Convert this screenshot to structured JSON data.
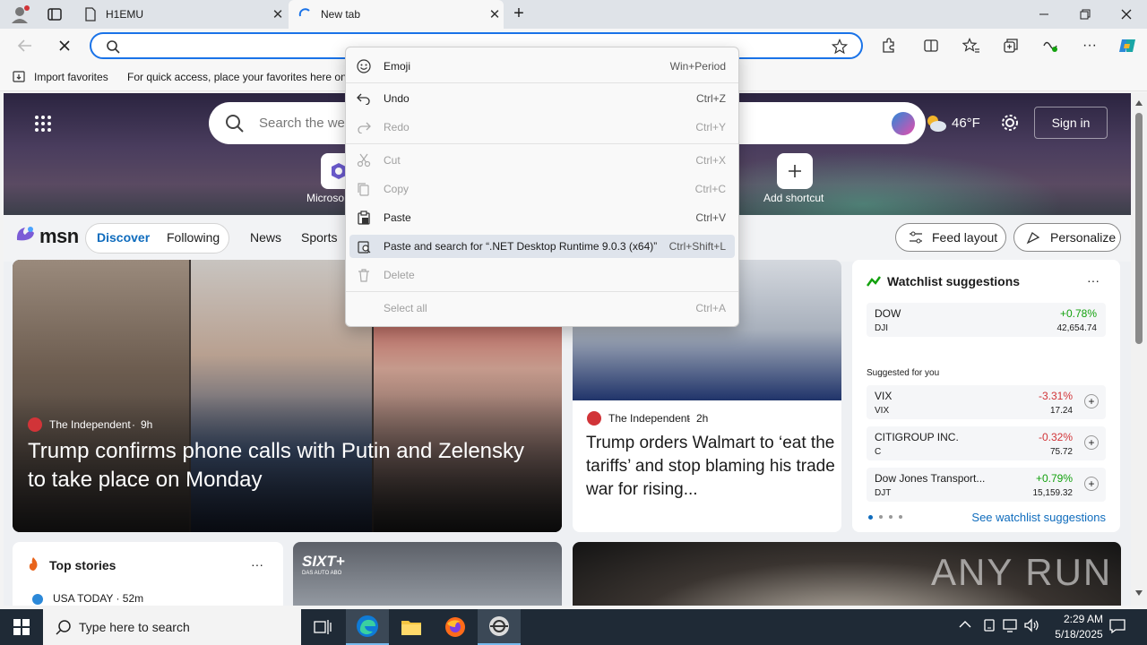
{
  "browser": {
    "tabs": [
      {
        "title": "H1EMU"
      },
      {
        "title": "New tab"
      }
    ],
    "favorites_bar": {
      "import_label": "Import favorites",
      "hint": "For quick access, place your favorites here on t"
    }
  },
  "msn": {
    "search_placeholder": "Search the we",
    "weather": "46°F",
    "sign_in": "Sign in",
    "shortcuts": {
      "first_label": "Microso",
      "add_label": "Add shortcut"
    },
    "logo": "msn",
    "nav": [
      "Discover",
      "Following",
      "News",
      "Sports"
    ],
    "feed_layout": "Feed layout",
    "personalize": "Personalize",
    "hero_story": {
      "source": "The Independent",
      "age": "9h",
      "headline": "Trump confirms phone calls with Putin and Zelensky to take place on Monday"
    },
    "side_story": {
      "source": "The Independent",
      "age": "2h",
      "headline": "Trump orders Walmart to ‘eat the tariffs’ and stop blaming his trade war for rising..."
    },
    "watchlist": {
      "title": "Watchlist suggestions",
      "more": "···",
      "primary": {
        "name": "DOW",
        "ticker": "DJI",
        "change": "+0.78%",
        "price": "42,654.74"
      },
      "suggested_label": "Suggested for you",
      "items": [
        {
          "name": "VIX",
          "ticker": "VIX",
          "change": "-3.31%",
          "price": "17.24"
        },
        {
          "name": "CITIGROUP INC.",
          "ticker": "C",
          "change": "-0.32%",
          "price": "75.72"
        },
        {
          "name": "Dow Jones Transport...",
          "ticker": "DJT",
          "change": "+0.79%",
          "price": "15,159.32"
        }
      ],
      "see_more": "See watchlist suggestions"
    },
    "top_stories": {
      "title": "Top stories",
      "more": "···",
      "first": "USA TODAY · 52m"
    },
    "ad_brand": "SIXT+",
    "ad_tagline": "DAS AUTO ABO",
    "watermark": "ANY RUN"
  },
  "context_menu": {
    "items": [
      {
        "label": "Emoji",
        "shortcut": "Win+Period"
      },
      {
        "label": "Undo",
        "shortcut": "Ctrl+Z"
      },
      {
        "label": "Redo",
        "shortcut": "Ctrl+Y"
      },
      {
        "label": "Cut",
        "shortcut": "Ctrl+X"
      },
      {
        "label": "Copy",
        "shortcut": "Ctrl+C"
      },
      {
        "label": "Paste",
        "shortcut": "Ctrl+V"
      },
      {
        "label": "Paste and search for “.NET Desktop Runtime 9.0.3 (x64)”",
        "shortcut": "Ctrl+Shift+L"
      },
      {
        "label": "Delete",
        "shortcut": ""
      },
      {
        "label": "Select all",
        "shortcut": "Ctrl+A"
      }
    ]
  },
  "taskbar": {
    "search_placeholder": "Type here to search",
    "time": "2:29 AM",
    "date": "5/18/2025"
  },
  "colors": {
    "accent": "#1a73e8",
    "positive": "#13a10e",
    "negative": "#d13438",
    "taskbar": "#1f2a36"
  }
}
